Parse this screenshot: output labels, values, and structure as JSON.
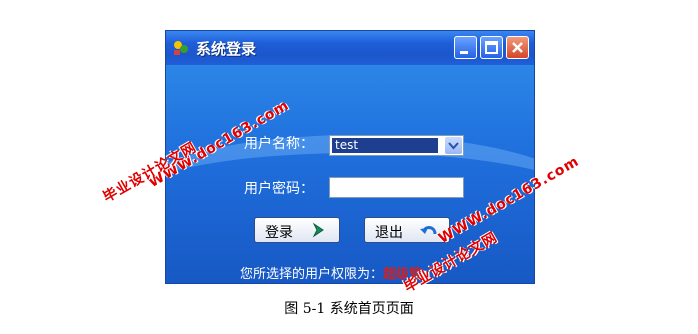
{
  "window": {
    "title": "系统登录",
    "controls": [
      "minimize-icon",
      "maximize-icon",
      "close-icon"
    ]
  },
  "form": {
    "user_label": "用户名称：",
    "user_value": "test",
    "password_label": "用户密码：",
    "password_value": "",
    "login_label": "登录",
    "exit_label": "退出",
    "permission_label": "您所选择的用户权限为：",
    "permission_value": "超级管"
  },
  "watermarks": {
    "site": "WWW.doc163.com",
    "text": "毕业设计论文网"
  },
  "caption": "图 5-1  系统首页页面",
  "colors": {
    "window_blue": "#1f63d6",
    "titlebar_blue": "#1e5ed8",
    "close_red": "#d5452a",
    "permission_red": "#d32020",
    "watermark_red": "#e00000"
  }
}
